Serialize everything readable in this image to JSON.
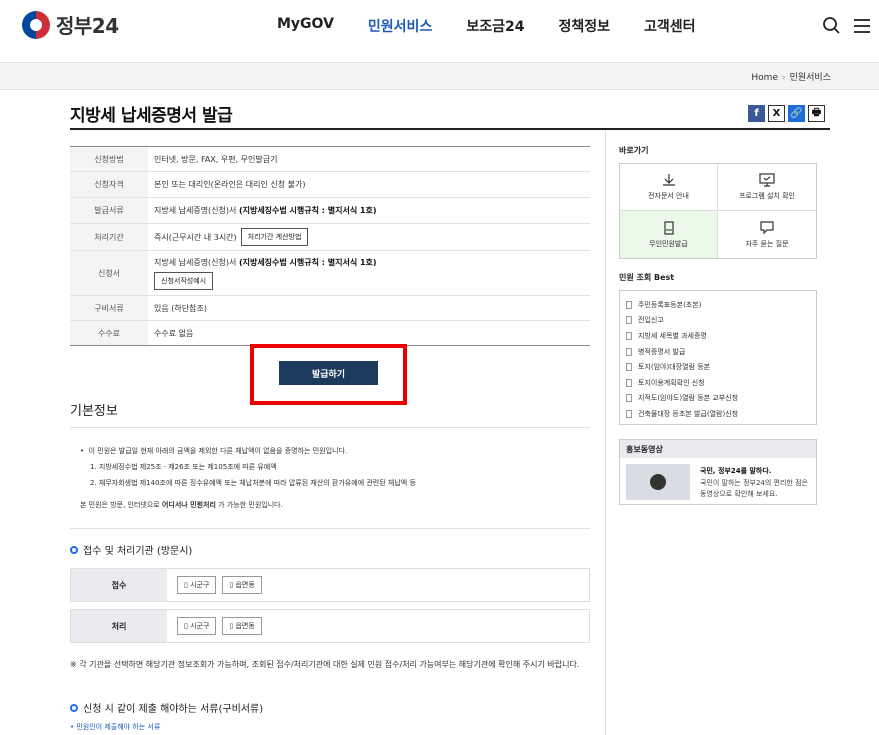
{
  "header": {
    "logo_text": "정부24",
    "nav": [
      "MyGOV",
      "민원서비스",
      "보조금24",
      "정책정보",
      "고객센터"
    ],
    "active_nav": 1
  },
  "breadcrumb": {
    "home": "Home",
    "current": "민원서비스"
  },
  "page_title": "지방세 납세증명서 발급",
  "share": {
    "facebook": "f",
    "x": "X",
    "link": "🔗",
    "print": "🖶"
  },
  "info": {
    "rows": [
      {
        "label": "신청방법",
        "value": "인터넷, 방문, FAX, 우편, 무인발급기"
      },
      {
        "label": "신청자격",
        "value": "본인 또는 대리인(온라인은 대리인 신청 불가)"
      },
      {
        "label": "발급서류",
        "value": "지방세 납세증명(신청)서 ",
        "bold": "(지방세징수법 시행규칙 : 별지서식 1호)"
      },
      {
        "label": "처리기간",
        "value": "즉시(근무시간 내 3시간)",
        "button": "처리기간 계산방법"
      },
      {
        "label": "신청서",
        "value": "지방세 납세증명(신청)서 ",
        "bold": "(지방세징수법 시행규칙 : 별지서식 1호)",
        "button": "신청서작성예시"
      },
      {
        "label": "구비서류",
        "value": "있음 (하단참조)"
      },
      {
        "label": "수수료",
        "value": "수수료 없음"
      }
    ]
  },
  "apply_button": "발급하기",
  "basic_info": {
    "title": "기본정보",
    "line1": "이 민원은 발급일 현재 아래의 금액을 제외한 다른 체납액이 없음을 증명하는 민원입니다.",
    "line2": "1. 지방세징수법 제25조 · 제26조 또는 제105조에 따른 유예액",
    "line3": "2. 채무자회생법 제140조에 따른 징수유예액 또는 체납처분에 따라 압류된 재산의 환가유예에 관련된 체납액 등",
    "line4_pre": "본 민원은 방문, 인터넷으로 ",
    "line4_bold": "어디서나 민원처리",
    "line4_post": " 가 가능한 민원입니다."
  },
  "processing": {
    "title": "접수 및 처리기관 (방문시)",
    "receive_label": "접수",
    "process_label": "처리",
    "tags": [
      "시군구",
      "읍면동"
    ]
  },
  "notice": "※ 각 기관을 선택하면 해당기관 정보조회가 가능하며, 조회된 접수/처리기관에 대한 실제 민원 접수/처리 가능여부는 해당기관에 확인해 주시기 바랍니다.",
  "docs": {
    "title": "신청 시 같이 제출 해야하는 서류(구비서류)",
    "sub": "• 민원인이 제출해야 하는 서류"
  },
  "side": {
    "shortcut_title": "바로가기",
    "shortcuts": [
      "전자문서 안내",
      "프로그램 설치 확인",
      "무인민원발급",
      "자주 묻는 질문"
    ],
    "best_title": "민원 조회 Best",
    "best": [
      "주민등록표등본(초본)",
      "전입신고",
      "지방세 세목별 과세증명",
      "병적증명서 발급",
      "토지(임야)대장열람 등본",
      "토지이용계획확인 신청",
      "지적도(임야도)열람 등본 교부신청",
      "건축물대장 등초본 발급(열람)신청"
    ],
    "video_title": "홍보동영상",
    "video_headline": "국민, 정부24를 말하다.",
    "video_desc1": "국민이 말하는 정부24의 편리한 점은",
    "video_desc2": "동영상으로 확인해 보세요."
  },
  "colors": {
    "accent": "#1e5bb8",
    "apply_bg": "#1b3a5c",
    "highlight": "#e00000"
  }
}
